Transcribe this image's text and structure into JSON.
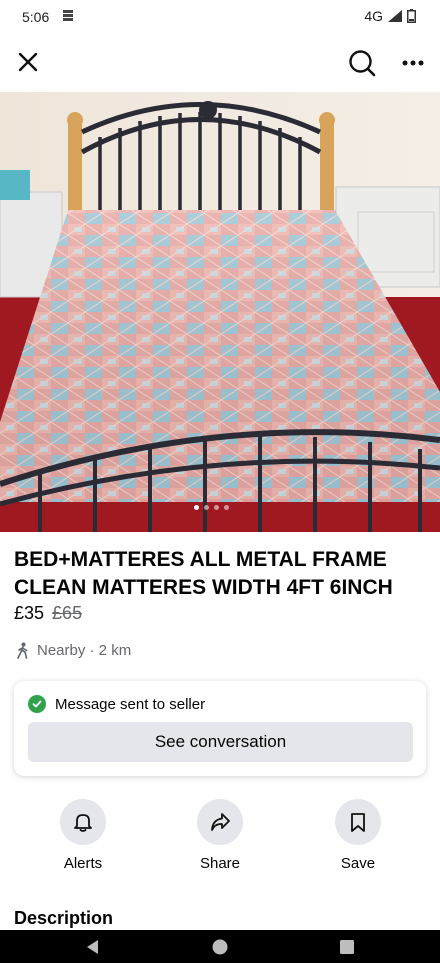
{
  "status_bar": {
    "time": "5:06",
    "network": "4G"
  },
  "listing": {
    "title": "BED+MATTERES ALL METAL FRAME CLEAN MATTERES WIDTH 4FT 6INCH",
    "price": "£35",
    "original_price": "£65",
    "location": "Nearby · 2 km",
    "image_count": 4,
    "active_image": 1
  },
  "message_card": {
    "status": "Message sent to seller",
    "button_label": "See conversation",
    "status_color": "#31a24c"
  },
  "actions": [
    {
      "label": "Alerts",
      "icon": "bell-icon"
    },
    {
      "label": "Share",
      "icon": "share-icon"
    },
    {
      "label": "Save",
      "icon": "bookmark-icon"
    }
  ],
  "description_heading": "Description",
  "icons": {
    "close": "close-icon",
    "search": "search-icon",
    "more": "more-icon",
    "location": "walking-person-icon"
  }
}
